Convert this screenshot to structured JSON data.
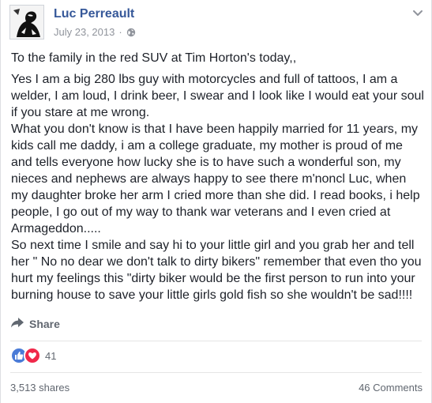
{
  "post": {
    "author": "Luc Perreault",
    "date": "July 23, 2013",
    "separator": "·",
    "privacy_icon": "globe-icon",
    "paragraphs": [
      "To the family in the red SUV at Tim Horton's today,,",
      "Yes I am a big 280 lbs guy with motorcycles and full of tattoos, I am a welder, I am loud, I drink beer, I swear and I look like I would eat your soul if you stare at me wrong.",
      "What you don't know is that I have been happily married for 11 years, my kids call me daddy, i am a college graduate, my mother is proud of me and tells everyone how lucky she is to have such a wonderful son, my nieces and nephews are always happy to see there m'noncl Luc, when my daughter broke her arm I cried more than she did. I read books, i help people, I go out of my way to thank war veterans and I even cried at Armageddon.....",
      "So next time I smile and say hi to your little girl and you grab her and tell her \" No no dear we don't talk to dirty bikers\" remember that even tho you hurt my feelings this \"dirty biker would be the first person to run into your burning house to save your little girls gold fish so she wouldn't be sad!!!!"
    ]
  },
  "actions": {
    "share_label": "Share",
    "share_icon": "share-arrow-icon"
  },
  "reactions": {
    "icons": [
      "like-icon",
      "love-icon"
    ],
    "count": "41",
    "like_color": "#4a7bd7",
    "love_color": "#f0284a"
  },
  "stats": {
    "shares": "3,513 shares",
    "comments": "46 Comments"
  },
  "colors": {
    "author": "#365899",
    "meta": "#90949c",
    "text": "#1d2129"
  }
}
